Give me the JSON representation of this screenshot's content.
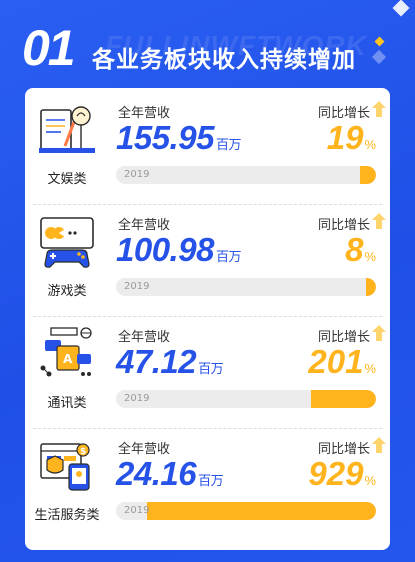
{
  "watermark": "FULLINWFTWORK",
  "header": {
    "number": "01",
    "title": "各业务板块收入持续增加"
  },
  "colors": {
    "background": "#2456ee",
    "accent_blue": "#2652e8",
    "accent_yellow": "#ffb41d",
    "bar_track": "#ececec"
  },
  "segments": [
    {
      "category": "文娱类",
      "icon": "desk-lamp-writing-icon",
      "revenue_label": "全年营收",
      "revenue": "155.95",
      "revenue_unit": "百万",
      "yoy_label": "同比增长",
      "yoy": "19",
      "yoy_unit": "%",
      "year": "2019",
      "bar_fraction": 0.06
    },
    {
      "category": "游戏类",
      "icon": "game-controller-icon",
      "revenue_label": "全年营收",
      "revenue": "100.98",
      "revenue_unit": "百万",
      "yoy_label": "同比增长",
      "yoy": "8",
      "yoy_unit": "%",
      "year": "2019",
      "bar_fraction": 0.04
    },
    {
      "category": "通讯类",
      "icon": "messaging-network-icon",
      "revenue_label": "全年营收",
      "revenue": "47.12",
      "revenue_unit": "百万",
      "yoy_label": "同比增长",
      "yoy": "201",
      "yoy_unit": "%",
      "year": "2019",
      "bar_fraction": 0.25
    },
    {
      "category": "生活服务类",
      "icon": "life-services-browser-icon",
      "revenue_label": "全年营收",
      "revenue": "24.16",
      "revenue_unit": "百万",
      "yoy_label": "同比增长",
      "yoy": "929",
      "yoy_unit": "%",
      "year": "2019",
      "bar_fraction": 0.88
    }
  ]
}
